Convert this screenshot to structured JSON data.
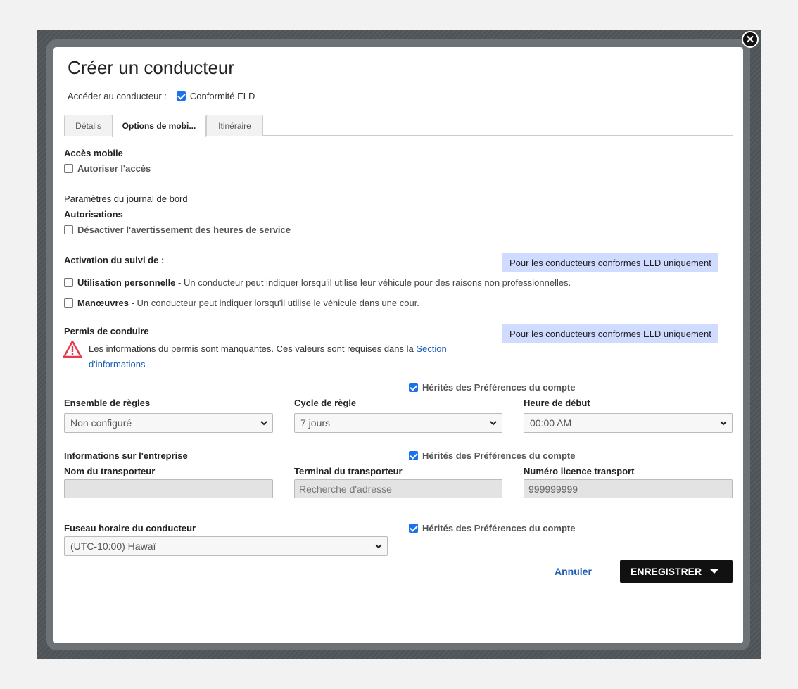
{
  "dialog": {
    "title": "Créer un conducteur",
    "access_label": "Accéder au conducteur :",
    "eld_compliance": "Conformité ELD"
  },
  "tabs": [
    {
      "label": "Détails"
    },
    {
      "label": "Options de mobi..."
    },
    {
      "label": "Itinéraire"
    }
  ],
  "mobile": {
    "heading": "Accès mobile",
    "allow_access": "Autoriser l'accès"
  },
  "logbook": {
    "heading": "Paramètres du journal de bord",
    "permissions": "Autorisations",
    "disable_warning": "Désactiver l'avertissement des heures de service"
  },
  "tracking": {
    "heading": "Activation du suivi de :",
    "badge": "Pour les conducteurs conformes ELD uniquement",
    "personal_label": "Utilisation personnelle",
    "personal_desc": " - Un conducteur peut indiquer lorsqu'il utilise leur véhicule pour des raisons non professionnelles.",
    "yard_label": "Manœuvres",
    "yard_desc": " - Un conducteur peut indiquer lorsqu'il utilise le véhicule dans une cour."
  },
  "license": {
    "heading": "Permis de conduire",
    "badge": "Pour les conducteurs conformes ELD uniquement",
    "warning_text": "Les informations du permis sont manquantes. Ces valeurs sont requises dans la ",
    "warning_link": "Section d'informations"
  },
  "rules": {
    "inherit": "Hérités des Préférences du compte",
    "ruleset_label": "Ensemble de règles",
    "ruleset_value": "Non configuré",
    "cycle_label": "Cycle de règle",
    "cycle_value": "7 jours",
    "start_label": "Heure de début",
    "start_value": "00:00 AM"
  },
  "company": {
    "heading": "Informations sur l'entreprise",
    "inherit": "Hérités des Préférences du compte",
    "carrier_name_label": "Nom du transporteur",
    "carrier_name_value": "",
    "terminal_label": "Terminal du transporteur",
    "terminal_placeholder": "Recherche d'adresse",
    "license_label": "Numéro licence transport",
    "license_value": "999999999"
  },
  "timezone": {
    "heading": "Fuseau horaire du conducteur",
    "inherit": "Hérités des Préférences du compte",
    "value": "(UTC-10:00) Hawaï"
  },
  "actions": {
    "cancel": "Annuler",
    "save": "ENREGISTRER"
  },
  "colors": {
    "accent": "#1a73e8",
    "badge_bg": "#cfdcff",
    "link": "#1a5fb4",
    "warning": "#e53950"
  }
}
